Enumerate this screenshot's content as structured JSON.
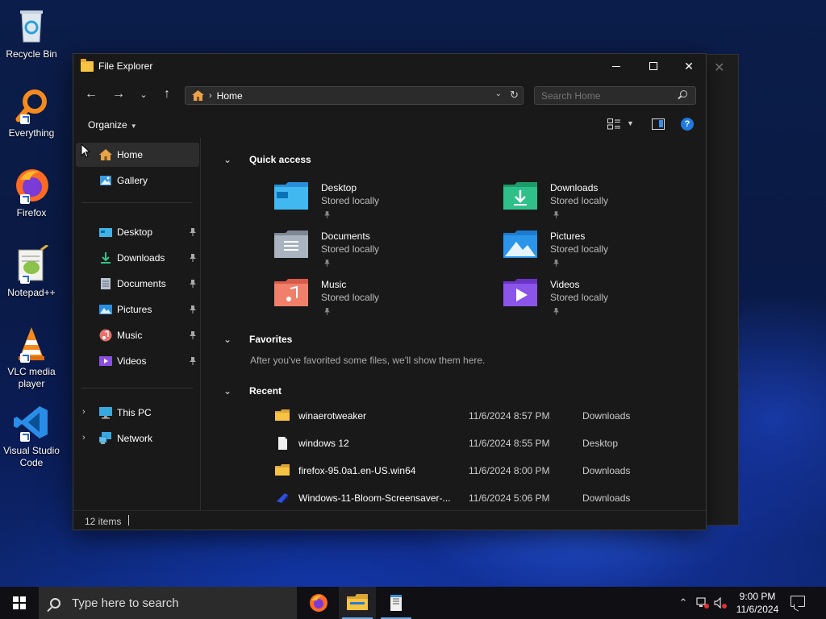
{
  "desktop": {
    "icons": [
      {
        "label": "Recycle Bin",
        "icon": "recycle-bin-icon"
      },
      {
        "label": "Everything",
        "icon": "everything-search-icon"
      },
      {
        "label": "Firefox",
        "icon": "firefox-icon"
      },
      {
        "label": "Notepad++",
        "icon": "notepad-plus-plus-icon"
      },
      {
        "label": "VLC media player",
        "icon": "vlc-icon"
      },
      {
        "label": "Visual Studio Code",
        "icon": "vscode-icon"
      }
    ]
  },
  "window": {
    "title": "File Explorer",
    "address": {
      "crumb": "Home"
    },
    "search": {
      "placeholder": "Search Home"
    },
    "command_bar": {
      "organize_label": "Organize"
    },
    "sidebar": {
      "home": "Home",
      "gallery": "Gallery",
      "pinned": [
        {
          "label": "Desktop",
          "icon": "desktop-folder-icon"
        },
        {
          "label": "Downloads",
          "icon": "downloads-folder-icon"
        },
        {
          "label": "Documents",
          "icon": "documents-folder-icon"
        },
        {
          "label": "Pictures",
          "icon": "pictures-folder-icon"
        },
        {
          "label": "Music",
          "icon": "music-folder-icon"
        },
        {
          "label": "Videos",
          "icon": "videos-folder-icon"
        }
      ],
      "this_pc": "This PC",
      "network": "Network"
    },
    "main": {
      "quick_access_title": "Quick access",
      "quick_access": [
        {
          "name": "Desktop",
          "sub": "Stored locally"
        },
        {
          "name": "Downloads",
          "sub": "Stored locally"
        },
        {
          "name": "Documents",
          "sub": "Stored locally"
        },
        {
          "name": "Pictures",
          "sub": "Stored locally"
        },
        {
          "name": "Music",
          "sub": "Stored locally"
        },
        {
          "name": "Videos",
          "sub": "Stored locally"
        }
      ],
      "favorites_title": "Favorites",
      "favorites_note": "After you've favorited some files, we'll show them here.",
      "recent_title": "Recent",
      "recent": [
        {
          "name": "winaerotweaker",
          "date": "11/6/2024 8:57 PM",
          "location": "Downloads",
          "icon": "folder-icon"
        },
        {
          "name": "windows 12",
          "date": "11/6/2024 8:55 PM",
          "location": "Desktop",
          "icon": "document-icon"
        },
        {
          "name": "firefox-95.0a1.en-US.win64",
          "date": "11/6/2024 8:00 PM",
          "location": "Downloads",
          "icon": "folder-icon"
        },
        {
          "name": "Windows-11-Bloom-Screensaver-...",
          "date": "11/6/2024 5:06 PM",
          "location": "Downloads",
          "icon": "screensaver-file-icon"
        }
      ]
    },
    "status": {
      "item_count": "12 items"
    }
  },
  "taskbar": {
    "search_placeholder": "Type here to search",
    "clock_time": "9:00 PM",
    "clock_date": "11/6/2024"
  },
  "colors": {
    "accent": "#1f7bdc",
    "window_bg": "#191919",
    "taskbar_bg": "#0f0f14",
    "folder_yellow": "#f6c343"
  }
}
